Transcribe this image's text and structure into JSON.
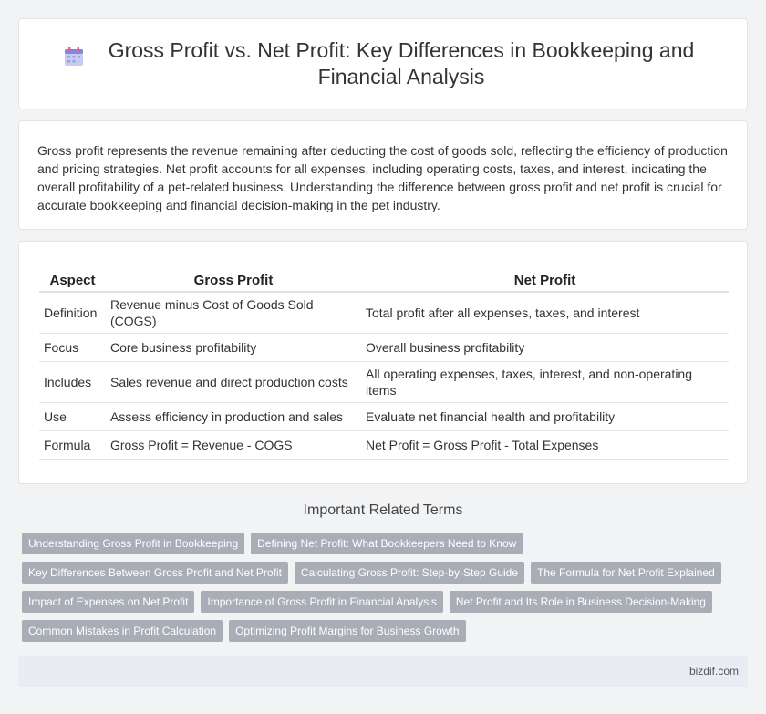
{
  "header": {
    "title": "Gross Profit vs. Net Profit: Key Differences in Bookkeeping and Financial Analysis",
    "icon": "calendar-icon"
  },
  "intro": {
    "text": "Gross profit represents the revenue remaining after deducting the cost of goods sold, reflecting the efficiency of production and pricing strategies. Net profit accounts for all expenses, including operating costs, taxes, and interest, indicating the overall profitability of a pet-related business. Understanding the difference between gross profit and net profit is crucial for accurate bookkeeping and financial decision-making in the pet industry."
  },
  "table": {
    "headers": [
      "Aspect",
      "Gross Profit",
      "Net Profit"
    ],
    "rows": [
      [
        "Definition",
        "Revenue minus Cost of Goods Sold (COGS)",
        "Total profit after all expenses, taxes, and interest"
      ],
      [
        "Focus",
        "Core business profitability",
        "Overall business profitability"
      ],
      [
        "Includes",
        "Sales revenue and direct production costs",
        "All operating expenses, taxes, interest, and non-operating items"
      ],
      [
        "Use",
        "Assess efficiency in production and sales",
        "Evaluate net financial health and profitability"
      ],
      [
        "Formula",
        "Gross Profit = Revenue - COGS",
        "Net Profit = Gross Profit - Total Expenses"
      ]
    ]
  },
  "related": {
    "title": "Important Related Terms",
    "tags": [
      [
        "Understanding Gross Profit in Bookkeeping",
        "Defining Net Profit: What Bookkeepers Need to Know"
      ],
      [
        "Key Differences Between Gross Profit and Net Profit",
        "Calculating Gross Profit: Step-by-Step Guide",
        "The Formula for Net Profit Explained"
      ],
      [
        "Impact of Expenses on Net Profit",
        "Importance of Gross Profit in Financial Analysis",
        "Net Profit and Its Role in Business Decision-Making"
      ],
      [
        "Common Mistakes in Profit Calculation",
        "Optimizing Profit Margins for Business Growth"
      ]
    ]
  },
  "footer": {
    "site": "bizdif.com"
  }
}
